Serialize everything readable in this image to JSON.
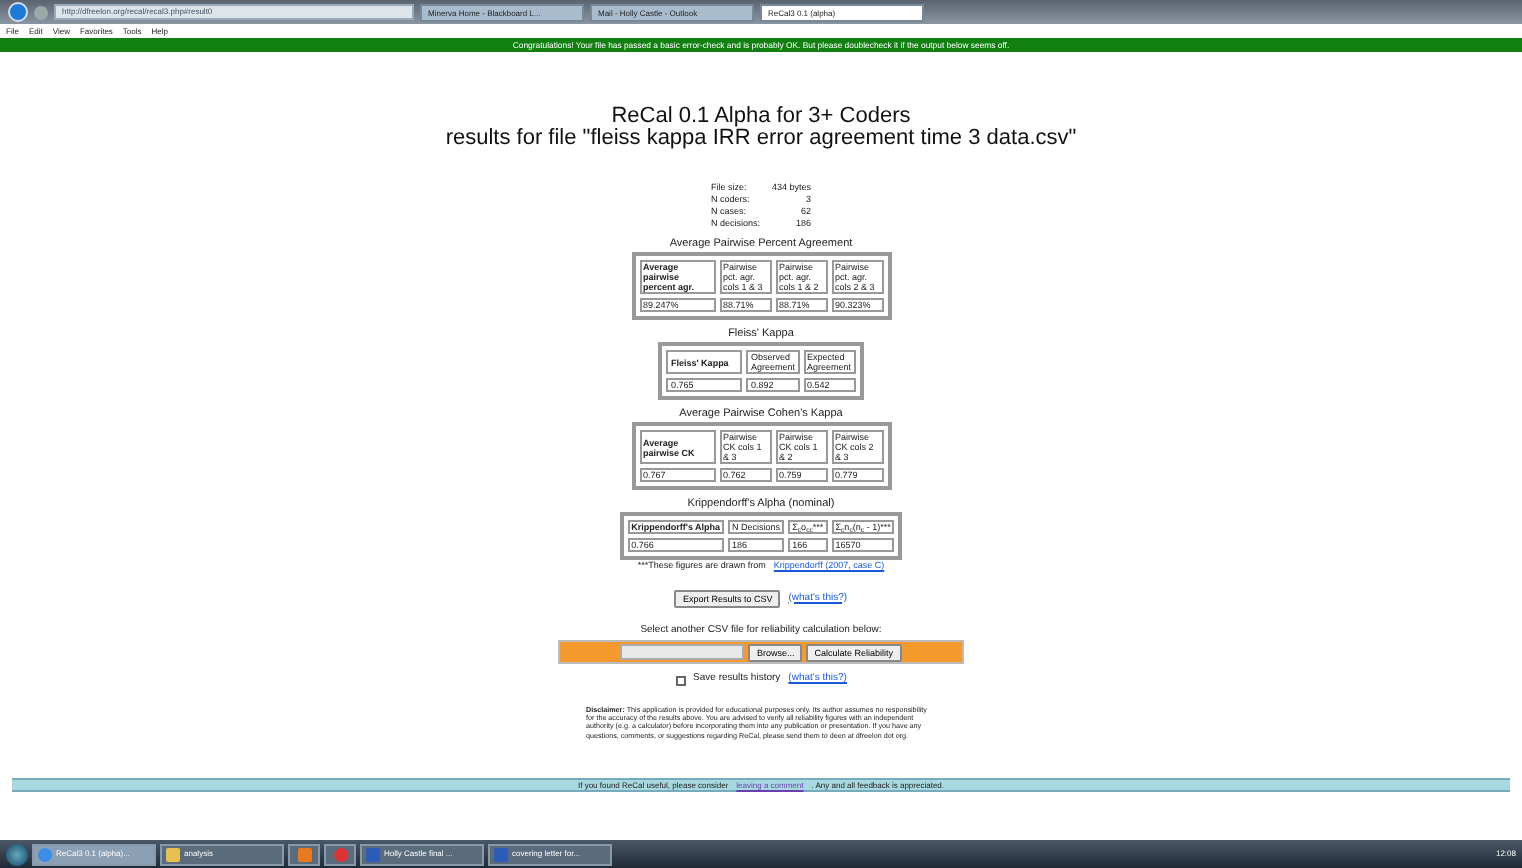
{
  "browser": {
    "address": "http://dfreelon.org/recal/recal3.php#result0",
    "tabs": [
      {
        "label": "Minerva Home - Blackboard L...",
        "selected": false
      },
      {
        "label": "Mail - Holly Castle - Outlook",
        "selected": false
      },
      {
        "label": "ReCal3 0.1 (alpha)",
        "selected": true
      }
    ],
    "menu": [
      "File",
      "Edit",
      "View",
      "Favorites",
      "Tools",
      "Help"
    ]
  },
  "banner": "Congratulations! Your file has passed a basic error-check and is probably OK. But please doublecheck it if the output below seems off.",
  "title": "ReCal 0.1 Alpha for 3+ Coders",
  "subtitle": "results for file \"fleiss kappa IRR error agreement time 3 data.csv\"",
  "file_info": [
    {
      "label": "File size:",
      "value": "434 bytes"
    },
    {
      "label": "N coders:",
      "value": "3"
    },
    {
      "label": "N cases:",
      "value": "62"
    },
    {
      "label": "N decisions:",
      "value": "186"
    }
  ],
  "tables": [
    {
      "title": "Average Pairwise Percent Agreement",
      "headers": [
        "Average pairwise percent agr.",
        "Pairwise pct. agr. cols 1 & 3",
        "Pairwise pct. agr. cols 1 & 2",
        "Pairwise pct. agr. cols 2 & 3"
      ],
      "values": [
        "89.247%",
        "88.71%",
        "88.71%",
        "90.323%"
      ]
    },
    {
      "title": "Fleiss' Kappa",
      "headers": [
        "Fleiss' Kappa",
        "Observed Agreement",
        "Expected Agreement"
      ],
      "values": [
        "0.765",
        "0.892",
        "0.542"
      ]
    },
    {
      "title": "Average Pairwise Cohen's Kappa",
      "headers": [
        "Average pairwise CK",
        "Pairwise CK cols 1 & 3",
        "Pairwise CK cols 1 & 2",
        "Pairwise CK cols 2 & 3"
      ],
      "values": [
        "0.767",
        "0.762",
        "0.759",
        "0.779"
      ]
    },
    {
      "title": "Krippendorff's Alpha (nominal)",
      "headers": [
        "Krippendorff's Alpha",
        "N Decisions",
        "Σ$_{c}$o$_{cc}$***",
        "Σ$_{c}$n$_{c}$(n$_{c}$ - 1)***"
      ],
      "values": [
        "0.766",
        "186",
        "166",
        "16570"
      ]
    }
  ],
  "footnote": {
    "text": "***These figures are drawn from",
    "link": "Krippendorff (2007, case C)"
  },
  "export": {
    "button": "Export Results to CSV",
    "link": "(what's this?)"
  },
  "upload": {
    "prompt": "Select another CSV file for reliability calculation below:",
    "browse": "Browse...",
    "calculate": "Calculate Reliability"
  },
  "save_history": {
    "label": "Save results history",
    "checked": false,
    "link": "(what's this?)"
  },
  "disclaimer": "**Disclaimer:** This application is provided for educational purposes only. Its author assumes no responsibility for the accuracy of the results above. You are advised to verify all reliability figures with an independent authority (e.g. a calculator) before incorporating them into any publication or presentation. If you have any questions, comments, or suggestions regarding ReCal, please send them to deen at dfreelon dot org.",
  "footer": {
    "before": "If you found ReCal useful, please consider",
    "link": "leaving a comment",
    "after": ". Any and all feedback is appreciated."
  },
  "taskbar": {
    "items": [
      {
        "kind": "ie",
        "label": "ReCal3 0.1 (alpha)...",
        "selected": true
      },
      {
        "kind": "folder",
        "label": "analysis",
        "selected": false
      },
      {
        "kind": "media",
        "selected": false
      },
      {
        "kind": "chrome",
        "selected": false
      },
      {
        "kind": "word",
        "label": "Holly Castle final ...",
        "selected": false
      },
      {
        "kind": "word",
        "label": "covering letter for...",
        "selected": false
      }
    ],
    "clock": "12:08"
  }
}
